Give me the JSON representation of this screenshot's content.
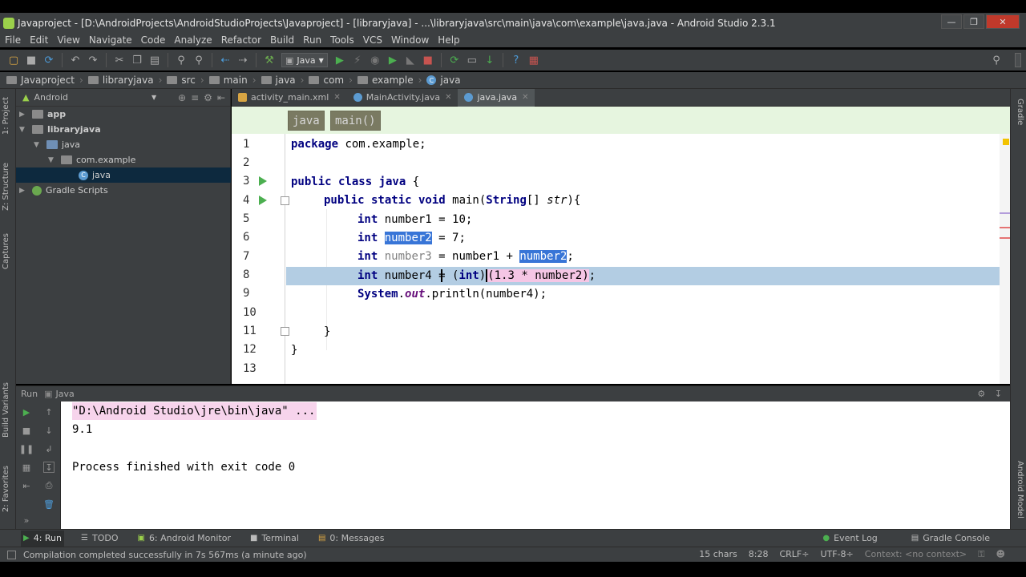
{
  "window": {
    "title": "Javaproject - [D:\\AndroidProjects\\AndroidStudioProjects\\Javaproject] - [libraryjava] - ...\\libraryjava\\src\\main\\java\\com\\example\\java.java - Android Studio 2.3.1",
    "minimize": "—",
    "maximize": "❐",
    "close": "✕"
  },
  "menu": [
    "File",
    "Edit",
    "View",
    "Navigate",
    "Code",
    "Analyze",
    "Refactor",
    "Build",
    "Run",
    "Tools",
    "VCS",
    "Window",
    "Help"
  ],
  "toolbar": {
    "config_label": "Java"
  },
  "breadcrumb": [
    "Javaproject",
    "libraryjava",
    "src",
    "main",
    "java",
    "com",
    "example",
    "java"
  ],
  "left_strip": {
    "project": "1: Project",
    "structure": "Z: Structure",
    "captures": "Captures",
    "build_variants": "Build Variants",
    "favorites": "2: Favorites"
  },
  "right_strip": {
    "gradle": "Gradle",
    "android_model": "Android Model"
  },
  "project_panel": {
    "view": "Android",
    "tree": [
      {
        "label": "app",
        "bold": true
      },
      {
        "label": "libraryjava",
        "bold": true
      },
      {
        "label": "java",
        "bold": false
      },
      {
        "label": "com.example",
        "bold": false
      },
      {
        "label": "java",
        "bold": false
      },
      {
        "label": "Gradle Scripts",
        "bold": false
      }
    ]
  },
  "editor_tabs": [
    {
      "label": "activity_main.xml",
      "active": false
    },
    {
      "label": "MainActivity.java",
      "active": false
    },
    {
      "label": "java.java",
      "active": true
    }
  ],
  "editor_breadcrumb": [
    "java",
    "main()"
  ],
  "line_numbers": [
    "1",
    "2",
    "3",
    "4",
    "5",
    "6",
    "7",
    "8",
    "9",
    "10",
    "11",
    "12",
    "13"
  ],
  "code": {
    "l1_kw": "package",
    "l1_rest": " com.example;",
    "l3_kw": "public class java",
    "l3_rest": " {",
    "l4_kw": "public static void",
    "l4_mid": " main(",
    "l4_type": "String",
    "l4_arr": "[] ",
    "l4_param": "str",
    "l4_end": "){",
    "l5_kw": "int",
    "l5_rest": " number1 = 10;",
    "l6_kw": "int",
    "l6_var": "number2",
    "l6_rest": " = 7;",
    "l7_kw": "int",
    "l7_var": " number3",
    "l7_mid": " = number1 + ",
    "l7_sel": "number2",
    "l7_end": ";",
    "l8_kw": "int",
    "l8_var": " number4",
    "l8_mid": " = (",
    "l8_cast": "int",
    "l8_close": ")",
    "l8_expr": "(1.3 * number2)",
    "l8_end": ";",
    "l9_class": "System",
    "l9_dot": ".",
    "l9_field": "out",
    "l9_rest": ".println(number4);",
    "l11": "}",
    "l12": "}"
  },
  "run_panel": {
    "title": "Run",
    "config": "Java",
    "console": [
      "\"D:\\Android Studio\\jre\\bin\\java\" ...",
      "9.1",
      "",
      "Process finished with exit code 0"
    ]
  },
  "bottom_tabs": [
    {
      "label": "4: Run",
      "icon": "▶"
    },
    {
      "label": "TODO",
      "icon": "☰"
    },
    {
      "label": "6: Android Monitor",
      "icon": "▣"
    },
    {
      "label": "Terminal",
      "icon": "■"
    },
    {
      "label": "0: Messages",
      "icon": "▤"
    }
  ],
  "bottom_right_tabs": [
    "Event Log",
    "Gradle Console"
  ],
  "status": {
    "message": "Compilation completed successfully in 7s 567ms (a minute ago)",
    "chars": "15 chars",
    "position": "8:28",
    "line_sep": "CRLF÷",
    "encoding": "UTF-8÷",
    "context": "Context: <no context>"
  },
  "colors": {
    "ide_bg": "#3c3f41",
    "editor_bg": "#ffffff",
    "keyword": "#000080",
    "selection": "#3875d7",
    "current_line": "#b3cde3",
    "breadcrumb_bar": "#e6f5df",
    "run_green": "#4caf50",
    "stop_red": "#c75450"
  }
}
